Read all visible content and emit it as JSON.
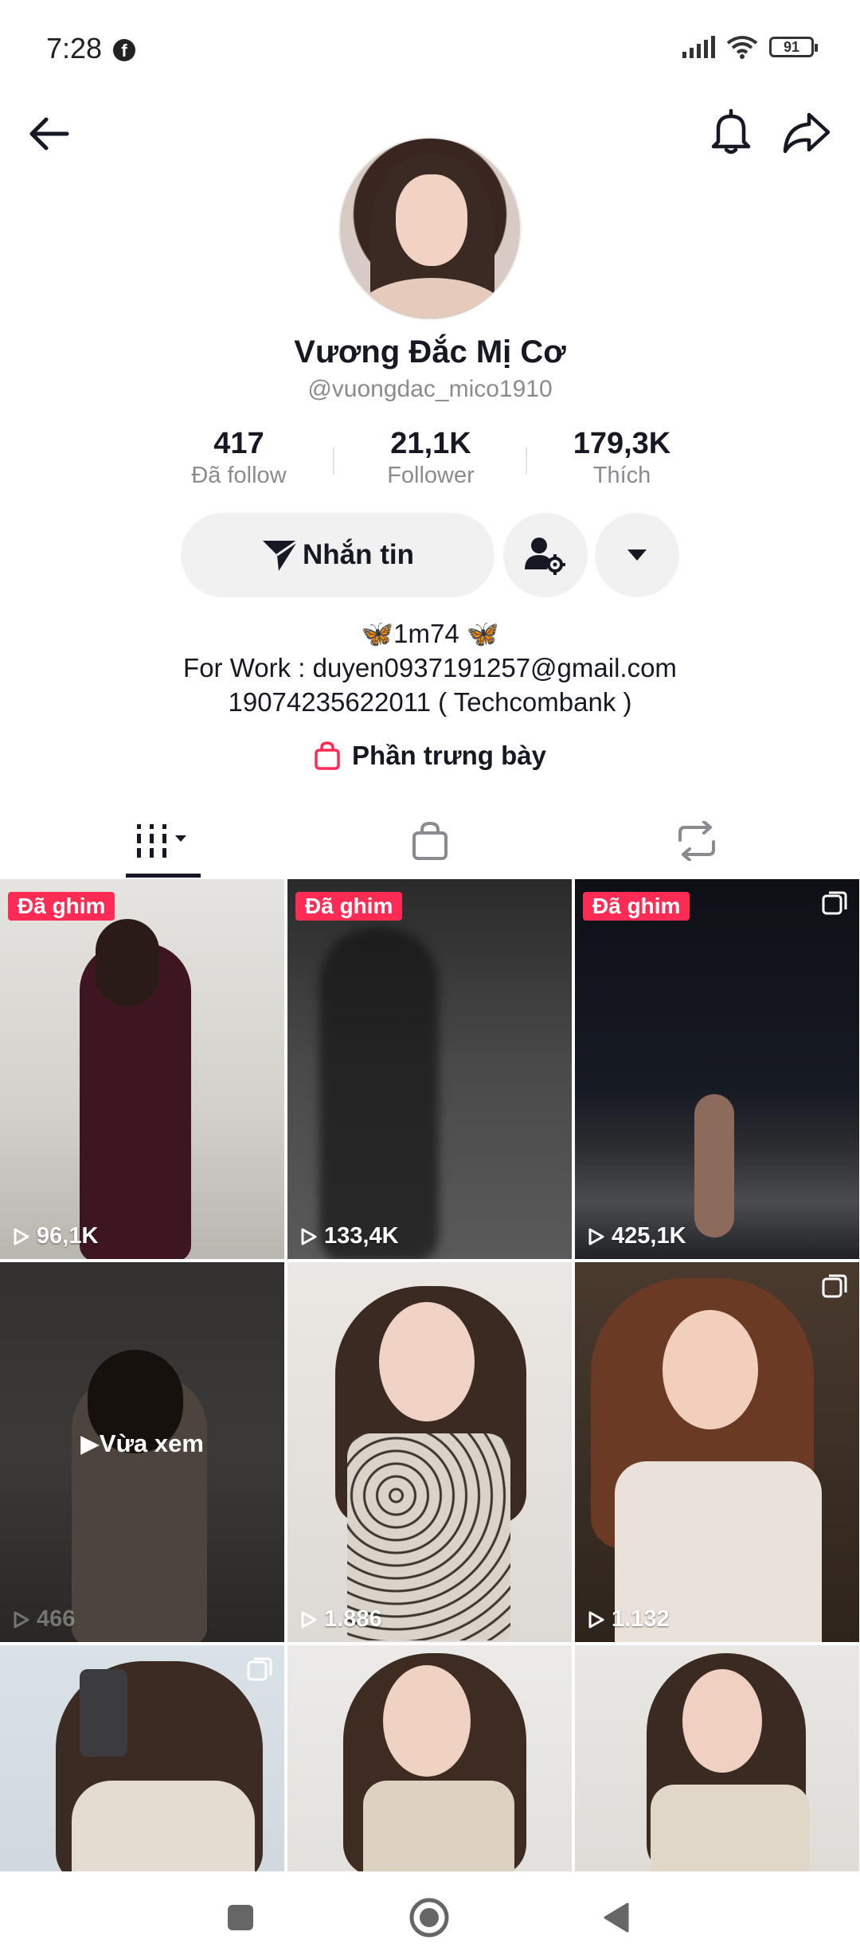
{
  "status_bar": {
    "time": "7:28",
    "battery": "91",
    "app_icon": "facebook-icon"
  },
  "profile": {
    "display_name": "Vương Đắc Mị Cơ",
    "username": "@vuongdac_mico1910"
  },
  "stats": [
    {
      "value": "417",
      "label": "Đã follow"
    },
    {
      "value": "21,1K",
      "label": "Follower"
    },
    {
      "value": "179,3K",
      "label": "Thích"
    }
  ],
  "actions": {
    "message_label": "Nhắn tin"
  },
  "bio": {
    "line1": "🦋1m74 🦋",
    "line2": "For Work : duyen0937191257@gmail.com",
    "line3": "19074235622011 ( Techcombank )"
  },
  "showcase_label": "Phần trưng bày",
  "tabs": [
    "videos-grid-icon",
    "shop-bag-icon",
    "repost-icon"
  ],
  "videos": [
    {
      "pinned_label": "Đã ghim",
      "views": "96,1K"
    },
    {
      "pinned_label": "Đã ghim",
      "views": "133,4K"
    },
    {
      "pinned_label": "Đã ghim",
      "views": "425,1K"
    },
    {
      "watched_label": "Vừa xem",
      "views": "466"
    },
    {
      "views": "1.886"
    },
    {
      "views": "1.132"
    },
    {
      "views": ""
    },
    {
      "views": ""
    },
    {
      "views": ""
    }
  ],
  "colors": {
    "accent": "#fe2c55",
    "text": "#161823",
    "muted": "#8a8b91",
    "button_bg": "#f1f1f2"
  }
}
